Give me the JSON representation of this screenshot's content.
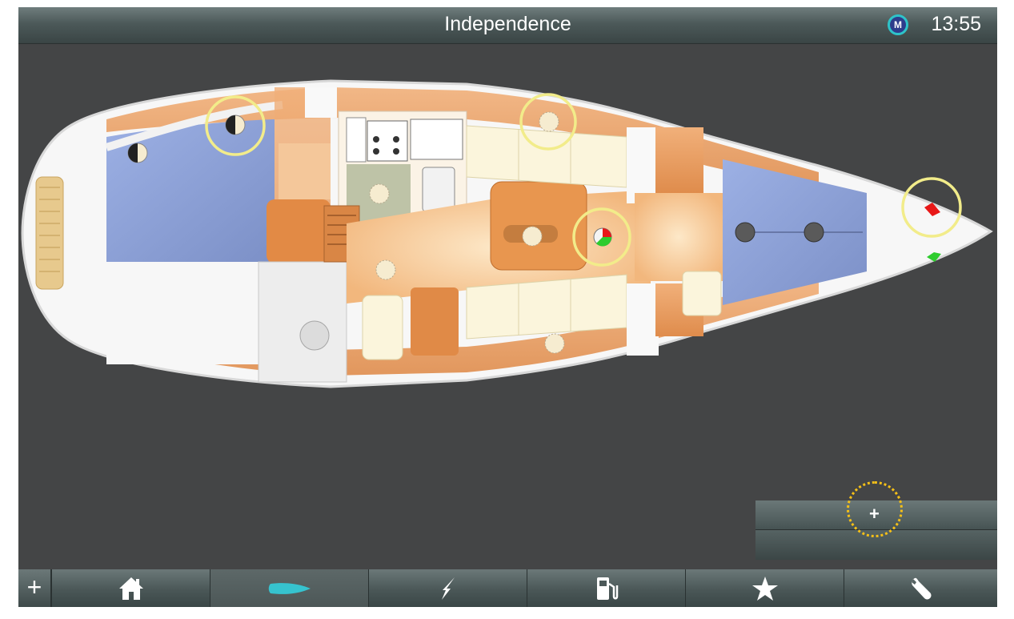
{
  "header": {
    "title": "Independence",
    "time": "13:55",
    "logo_letter": "M"
  },
  "plan": {
    "lights": [
      {
        "name": "aft-port-light",
        "state": "half",
        "selected": true
      },
      {
        "name": "aft-cabin-light",
        "state": "half",
        "selected": false
      },
      {
        "name": "nav-table-light",
        "state": "on",
        "selected": false
      },
      {
        "name": "galley-light",
        "state": "on",
        "selected": false
      },
      {
        "name": "starboard-settee-light",
        "state": "on",
        "selected": true
      },
      {
        "name": "saloon-light",
        "state": "on",
        "selected": false
      },
      {
        "name": "mast-tricolor-light",
        "state": "tricolor",
        "selected": true
      },
      {
        "name": "port-settee-light",
        "state": "on",
        "selected": false
      },
      {
        "name": "forward-cabin-light-1",
        "state": "off",
        "selected": false
      },
      {
        "name": "forward-cabin-light-2",
        "state": "off",
        "selected": false
      },
      {
        "name": "bow-red-light",
        "state": "red",
        "selected": true
      },
      {
        "name": "bow-green-light",
        "state": "green",
        "selected": false
      }
    ],
    "colors": {
      "bulb_on": "#f6ecd0",
      "bulb_off": "#5a5a5a",
      "highlight_ring": "#f2ec8a",
      "berth": "#8fa3d8",
      "wood": "#e79a5a",
      "nav_red": "#e81818",
      "nav_green": "#2ecc2e"
    }
  },
  "action_panel": {
    "add_label": "+",
    "ring_color": "#f5c018"
  },
  "nav": {
    "add_label": "+",
    "items": [
      {
        "icon": "home-icon",
        "active": false
      },
      {
        "icon": "boat-icon",
        "active": true,
        "color": "#36c3cf"
      },
      {
        "icon": "power-icon",
        "active": false
      },
      {
        "icon": "fuel-pump-icon",
        "active": false
      },
      {
        "icon": "star-icon",
        "active": false
      },
      {
        "icon": "wrench-icon",
        "active": false
      }
    ]
  }
}
